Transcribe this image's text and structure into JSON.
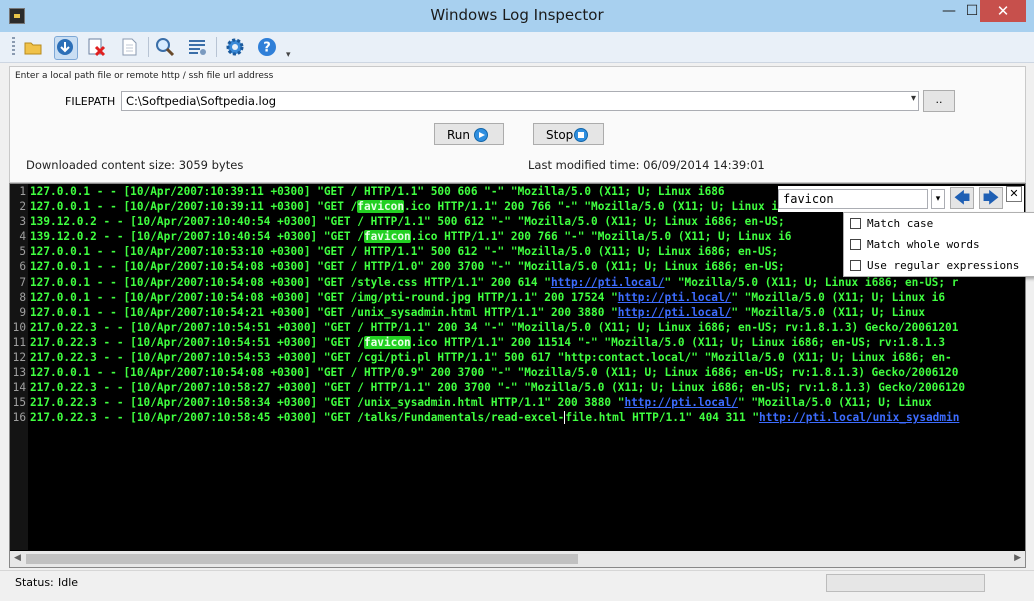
{
  "window": {
    "title": "Windows Log Inspector"
  },
  "input_panel": {
    "hint": "Enter a local path file or remote http / ssh file url address",
    "filepath_label": "FILEPATH",
    "filepath_value": "C:\\Softpedia\\Softpedia.log",
    "browse_label": "..",
    "run_label": "Run",
    "stop_label": "Stop",
    "downloaded": "Downloaded content size: 3059 bytes",
    "modified": "Last modified time: 06/09/2014 14:39:01"
  },
  "find": {
    "value": "favicon",
    "options": [
      "Match case",
      "Match whole words",
      "Use regular expressions"
    ]
  },
  "log_lines": [
    [
      "127.0.0.1 - - [10/Apr/2007:10:39:11 +0300] \"GET / HTTP/1.1\" 500 606 \"-\" \"Mozilla/5.0 (X11; U; Linux i686"
    ],
    [
      "127.0.0.1 - - [10/Apr/2007:10:39:11 +0300] \"GET /",
      {
        "hl": "favicon"
      },
      ".ico HTTP/1.1\" 200 766 \"-\" \"Mozilla/5.0 (X11; U; Linux i6"
    ],
    [
      "139.12.0.2 - - [10/Apr/2007:10:40:54 +0300] \"GET / HTTP/1.1\" 500 612 \"-\" \"Mozilla/5.0 (X11; U; Linux i686; en-US;"
    ],
    [
      "139.12.0.2 - - [10/Apr/2007:10:40:54 +0300] \"GET /",
      {
        "hl": "favicon"
      },
      ".ico HTTP/1.1\" 200 766 \"-\" \"Mozilla/5.0 (X11; U; Linux i6"
    ],
    [
      "127.0.0.1 - - [10/Apr/2007:10:53:10 +0300] \"GET / HTTP/1.1\" 500 612 \"-\" \"Mozilla/5.0 (X11; U; Linux i686; en-US;"
    ],
    [
      "127.0.0.1 - - [10/Apr/2007:10:54:08 +0300] \"GET / HTTP/1.0\" 200 3700 \"-\" \"Mozilla/5.0 (X11; U; Linux i686; en-US;"
    ],
    [
      "127.0.0.1 - - [10/Apr/2007:10:54:08 +0300] \"GET /style.css HTTP/1.1\" 200 614 \"",
      {
        "url": "http://pti.local/"
      },
      "\" \"Mozilla/5.0 (X11; U; Linux i686; en-US; r"
    ],
    [
      "127.0.0.1 - - [10/Apr/2007:10:54:08 +0300] \"GET /img/pti-round.jpg HTTP/1.1\" 200 17524 \"",
      {
        "url": "http://pti.local/"
      },
      "\" \"Mozilla/5.0 (X11; U; Linux i6"
    ],
    [
      "127.0.0.1 - - [10/Apr/2007:10:54:21 +0300] \"GET /unix_sysadmin.html HTTP/1.1\" 200 3880 \"",
      {
        "url": "http://pti.local/"
      },
      "\" \"Mozilla/5.0 (X11; U; Linux"
    ],
    [
      "217.0.22.3 - - [10/Apr/2007:10:54:51 +0300] \"GET / HTTP/1.1\" 200 34 \"-\" \"Mozilla/5.0 (X11; U; Linux i686; en-US; rv:1.8.1.3) Gecko/20061201"
    ],
    [
      "217.0.22.3 - - [10/Apr/2007:10:54:51 +0300] \"GET /",
      {
        "hl": "favicon"
      },
      ".ico HTTP/1.1\" 200 11514 \"-\" \"Mozilla/5.0 (X11; U; Linux i686; en-US; rv:1.8.1.3"
    ],
    [
      "217.0.22.3 - - [10/Apr/2007:10:54:53 +0300] \"GET /cgi/pti.pl HTTP/1.1\" 500 617 \"http:contact.local/\" \"Mozilla/5.0 (X11; U; Linux i686; en-"
    ],
    [
      "127.0.0.1 - - [10/Apr/2007:10:54:08 +0300] \"GET / HTTP/0.9\" 200 3700 \"-\" \"Mozilla/5.0 (X11; U; Linux i686; en-US; rv:1.8.1.3) Gecko/2006120"
    ],
    [
      "217.0.22.3 - - [10/Apr/2007:10:58:27 +0300] \"GET / HTTP/1.1\" 200 3700 \"-\" \"Mozilla/5.0 (X11; U; Linux i686; en-US; rv:1.8.1.3) Gecko/2006120"
    ],
    [
      "217.0.22.3 - - [10/Apr/2007:10:58:34 +0300] \"GET /unix_sysadmin.html HTTP/1.1\" 200 3880 \"",
      {
        "url": "http://pti.local/"
      },
      "\" \"Mozilla/5.0 (X11; U; Linux"
    ],
    [
      "217.0.22.3 - - [10/Apr/2007:10:58:45 +0300] \"GET /talks/Fundamentals/read-excel-",
      {
        "cursor": "f"
      },
      "ile.html HTTP/1.1\" 404 311 \"",
      {
        "url": "http://pti.local/unix_sysadmin"
      }
    ]
  ],
  "status": {
    "label": "Status:",
    "value": "Idle"
  },
  "colors": {
    "log_text": "#40ff40",
    "highlight": "#22d022",
    "link": "#3d6cff",
    "titlebar": "#a8d0ef",
    "close_button": "#c7504c"
  },
  "toolbar_icons": [
    "open-folder-icon",
    "download-icon",
    "delete-icon",
    "new-document-icon",
    "search-icon",
    "list-settings-icon",
    "settings-gear-icon",
    "help-icon"
  ],
  "titlebar_icons": {
    "minimize": "—",
    "maximize": "☐",
    "close": "✕"
  }
}
